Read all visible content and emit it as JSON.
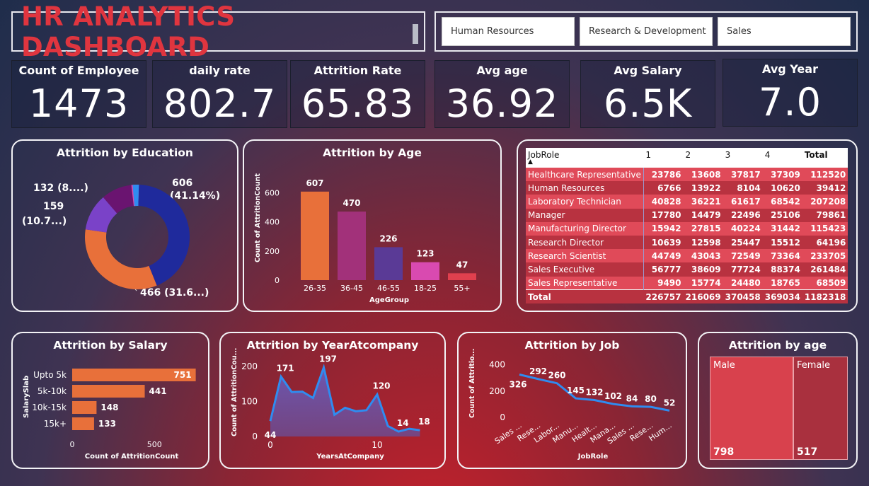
{
  "header": {
    "title": "HR ANALYTICS DASHBOARD"
  },
  "slicer": {
    "options": [
      "Human Resources",
      "Research & Development",
      "Sales"
    ]
  },
  "kpis": [
    {
      "label": "Count of Employee",
      "value": "1473"
    },
    {
      "label": "daily rate",
      "value": "802.7"
    },
    {
      "label": "Attrition Rate",
      "value": "65.83"
    },
    {
      "label": "Avg age",
      "value": "36.92"
    },
    {
      "label": "Avg Salary",
      "value": "6.5K"
    },
    {
      "label": "Avg Year",
      "value": "7.0"
    }
  ],
  "colors": {
    "accent_red": "#e0353f",
    "orange": "#e8703a",
    "purple": "#9b2f7e",
    "violet": "#5a3a96",
    "pink": "#d94ab0",
    "navy": "#1f2a9c",
    "blue": "#2f8cf0",
    "table_row_light": "#e04a59",
    "table_row_dark": "#b83240"
  },
  "education": {
    "title": "Attrition by Education",
    "labels": [
      "606",
      "(41.14%)",
      "466 (31.6...)",
      "159",
      "(10.7...)",
      "132 (8....)"
    ]
  },
  "table": {
    "headers": [
      "JobRole",
      "1",
      "2",
      "3",
      "4",
      "Total"
    ],
    "rows": [
      [
        "Healthcare Representative",
        "23786",
        "13608",
        "37817",
        "37309",
        "112520"
      ],
      [
        "Human Resources",
        "6766",
        "13922",
        "8104",
        "10620",
        "39412"
      ],
      [
        "Laboratory Technician",
        "40828",
        "36221",
        "61617",
        "68542",
        "207208"
      ],
      [
        "Manager",
        "17780",
        "14479",
        "22496",
        "25106",
        "79861"
      ],
      [
        "Manufacturing Director",
        "15942",
        "27815",
        "40224",
        "31442",
        "115423"
      ],
      [
        "Research Director",
        "10639",
        "12598",
        "25447",
        "15512",
        "64196"
      ],
      [
        "Research Scientist",
        "44749",
        "43043",
        "72549",
        "73364",
        "233705"
      ],
      [
        "Sales Executive",
        "56777",
        "38609",
        "77724",
        "88374",
        "261484"
      ],
      [
        "Sales Representative",
        "9490",
        "15774",
        "24480",
        "18765",
        "68509"
      ]
    ],
    "total": [
      "Total",
      "226757",
      "216069",
      "370458",
      "369034",
      "1182318"
    ]
  },
  "treemap": {
    "title": "Attrition by age",
    "cells": [
      {
        "label": "Male",
        "value": "798"
      },
      {
        "label": "Female",
        "value": "517"
      }
    ]
  },
  "chart_data": [
    {
      "type": "pie",
      "title": "Attrition by Education",
      "categories": [
        "",
        "",
        "",
        "",
        ""
      ],
      "values": [
        606,
        466,
        159,
        132,
        32
      ],
      "data_labels": [
        "606 (41.14%)",
        "466 (31.6...)",
        "159 (10.7...)",
        "132 (8....)",
        ""
      ]
    },
    {
      "type": "bar",
      "title": "Attrition by Age",
      "categories": [
        "26-35",
        "36-45",
        "46-55",
        "18-25",
        "55+"
      ],
      "values": [
        607,
        470,
        226,
        123,
        47
      ],
      "xlabel": "AgeGroup",
      "ylabel": "Count of AttritionCount",
      "yticks": [
        "0",
        "200",
        "400",
        "600"
      ],
      "ylim": [
        0,
        650
      ]
    },
    {
      "type": "bar",
      "title": "Attrition by Salary",
      "categories": [
        "Upto 5k",
        "5k-10k",
        "10k-15k",
        "15k+"
      ],
      "values": [
        751,
        441,
        148,
        133
      ],
      "xlabel": "Count of AttritionCount",
      "ylabel": "SalarySlab",
      "xticks": [
        "0",
        "500"
      ],
      "xlim": [
        0,
        800
      ]
    },
    {
      "type": "area",
      "title": "Attrition by YearAtcompany",
      "x": [
        0,
        1,
        2,
        3,
        4,
        5,
        6,
        7,
        8,
        9,
        10,
        11,
        12,
        13,
        14
      ],
      "values": [
        44,
        171,
        127,
        128,
        110,
        197,
        62,
        82,
        72,
        75,
        120,
        30,
        14,
        22,
        18
      ],
      "labeled_points": {
        "0": "44",
        "1": "171",
        "5": "197",
        "10": "120",
        "12": "14",
        "14": "18"
      },
      "xlabel": "YearsAtCompany",
      "ylabel": "Count of AttritionCou...",
      "yticks": [
        "0",
        "100",
        "200"
      ],
      "xticks": [
        "0",
        "10"
      ],
      "ylim": [
        0,
        210
      ]
    },
    {
      "type": "line",
      "title": "Attrition by Job",
      "categories": [
        "Sales ...",
        "Rese...",
        "Labor...",
        "Manu...",
        "Healt...",
        "Mana...",
        "Sales ...",
        "Rese...",
        "Hum..."
      ],
      "values": [
        326,
        292,
        260,
        145,
        132,
        102,
        84,
        80,
        52
      ],
      "xlabel": "JobRole",
      "ylabel": "Count of Attritio...",
      "yticks": [
        "0",
        "200",
        "400"
      ],
      "ylim": [
        0,
        420
      ]
    }
  ]
}
